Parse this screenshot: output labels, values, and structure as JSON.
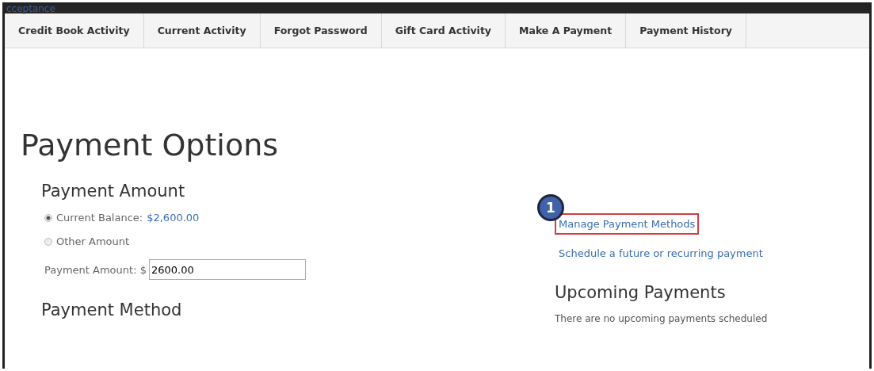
{
  "header": {
    "title": "cceptance"
  },
  "tabs": [
    {
      "label": "Credit Book Activity"
    },
    {
      "label": "Current Activity"
    },
    {
      "label": "Forgot Password"
    },
    {
      "label": "Gift Card Activity"
    },
    {
      "label": "Make A Payment"
    },
    {
      "label": "Payment History"
    }
  ],
  "page_title": "Payment Options",
  "payment_amount": {
    "heading": "Payment Amount",
    "options": [
      {
        "label": "Current Balance:",
        "amount": "$2,600.00",
        "selected": true
      },
      {
        "label": "Other Amount",
        "selected": false
      }
    ],
    "field_label": "Payment Amount: $",
    "field_value": "2600.00"
  },
  "payment_method": {
    "heading": "Payment Method"
  },
  "links": [
    {
      "label": "Manage Payment Methods",
      "highlighted": true,
      "callout": "1"
    },
    {
      "label": "Schedule a future or recurring payment",
      "highlighted": false
    }
  ],
  "upcoming": {
    "heading": "Upcoming Payments",
    "message": "There are no upcoming payments scheduled"
  }
}
